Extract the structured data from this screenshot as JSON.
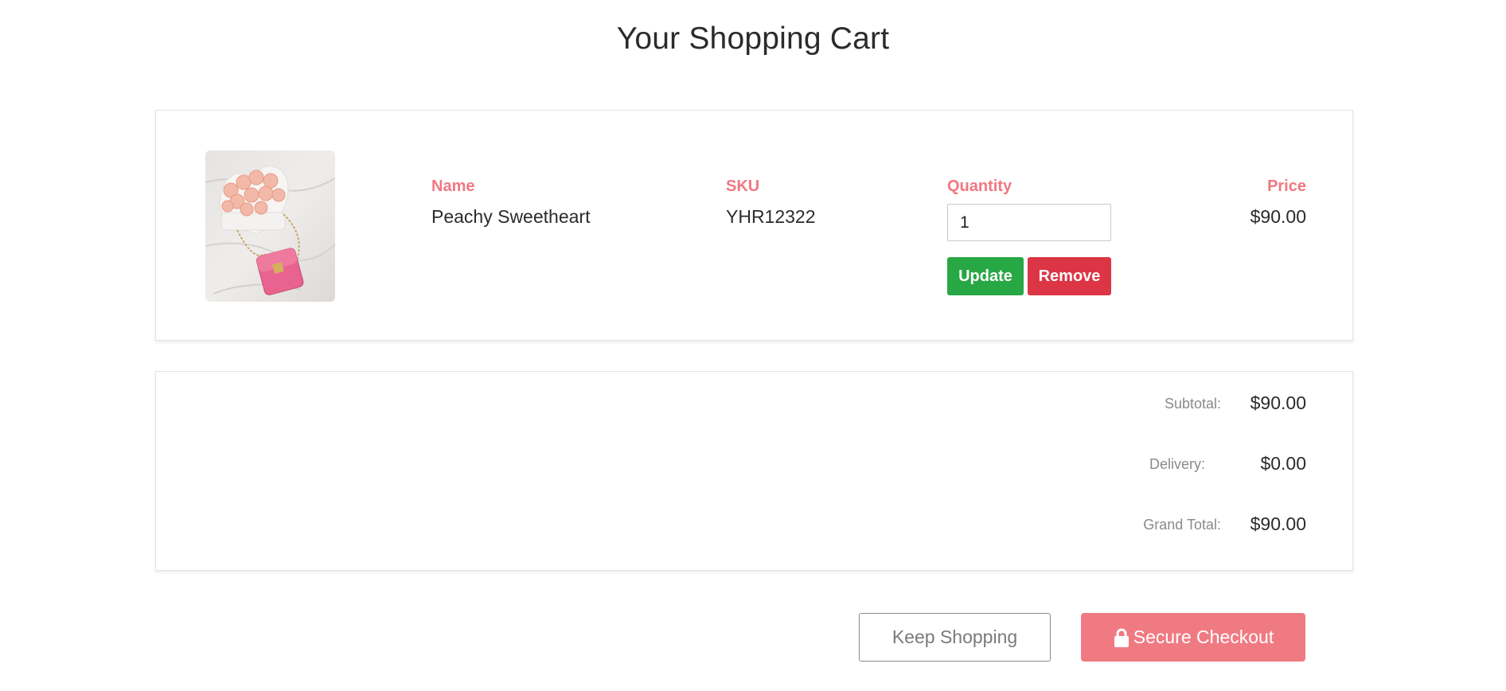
{
  "page_title": "Your Shopping Cart",
  "cart": {
    "columns": {
      "name": "Name",
      "sku": "SKU",
      "quantity": "Quantity",
      "price": "Price"
    },
    "items": [
      {
        "image_icon": "product-photo-roses-and-pink-bag",
        "name": "Peachy Sweetheart",
        "sku": "YHR12322",
        "quantity": "1",
        "price": "$90.00",
        "update_label": "Update",
        "remove_label": "Remove"
      }
    ]
  },
  "totals": {
    "subtotal_label": "Subtotal:",
    "subtotal_value": "$90.00",
    "delivery_label": "Delivery:",
    "delivery_value": "$0.00",
    "grand_total_label": "Grand Total:",
    "grand_total_value": "$90.00"
  },
  "actions": {
    "keep_shopping_label": "Keep Shopping",
    "checkout_label": "Secure Checkout",
    "checkout_icon": "lock-icon"
  },
  "colors": {
    "accent": "#f07882",
    "update_button": "#28a745",
    "remove_button": "#dc3545",
    "checkout_button": "#f07a82"
  }
}
